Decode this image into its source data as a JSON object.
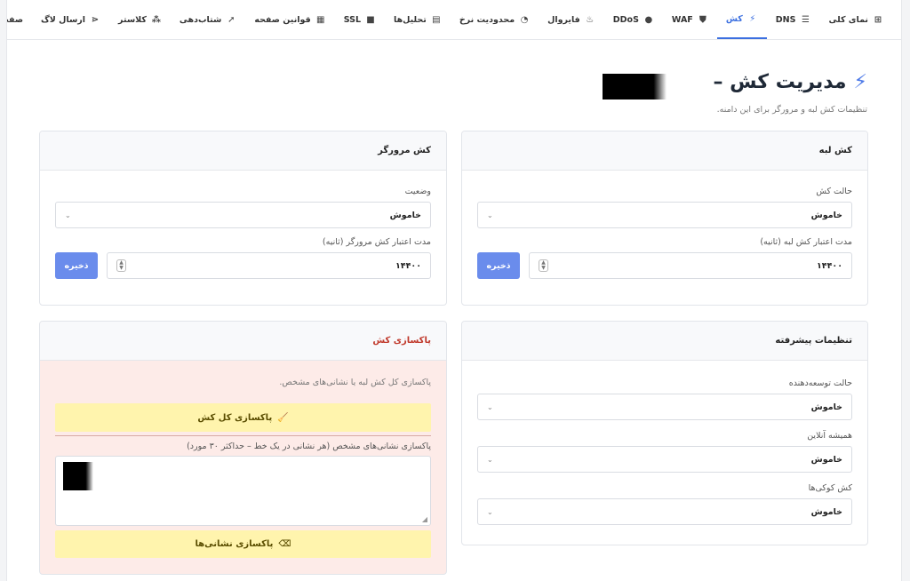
{
  "tabs": [
    {
      "label": "نمای کلی",
      "icon": "grid-icon",
      "glyph": "⊞",
      "active": false
    },
    {
      "label": "DNS",
      "icon": "server-icon",
      "glyph": "☰",
      "active": false
    },
    {
      "label": "کش",
      "icon": "bolt-icon",
      "glyph": "⚡",
      "active": true
    },
    {
      "label": "WAF",
      "icon": "shield-icon",
      "glyph": "⛊",
      "active": false
    },
    {
      "label": "DDoS",
      "icon": "bomb-icon",
      "glyph": "●",
      "active": false
    },
    {
      "label": "فایروال",
      "icon": "fire-icon",
      "glyph": "♨",
      "active": false
    },
    {
      "label": "محدودیت نرخ",
      "icon": "gauge-icon",
      "glyph": "◔",
      "active": false
    },
    {
      "label": "تحلیل‌ها",
      "icon": "chart-icon",
      "glyph": "▤",
      "active": false
    },
    {
      "label": "SSL",
      "icon": "lock-icon",
      "glyph": "■",
      "active": false
    },
    {
      "label": "قوانین صفحه",
      "icon": "list-icon",
      "glyph": "▦",
      "active": false
    },
    {
      "label": "شتاب‌دهی",
      "icon": "rocket-icon",
      "glyph": "➚",
      "active": false
    },
    {
      "label": "کلاستر",
      "icon": "cubes-icon",
      "glyph": "⁂",
      "active": false
    },
    {
      "label": "ارسال لاگ",
      "icon": "share-icon",
      "glyph": "⋖",
      "active": false
    },
    {
      "label": "صفحات سفارشی",
      "icon": "",
      "glyph": "",
      "active": false
    }
  ],
  "header": {
    "title": "مدیریت کش –",
    "subtitle": "تنظیمات کش لبه و مرورگر برای این دامنه."
  },
  "edge": {
    "title": "کش لبه",
    "mode_label": "حالت کش",
    "mode_value": "خاموش",
    "ttl_label": "مدت اعتبار کش لبه (ثانیه)",
    "ttl_value": "۱۴۴۰۰",
    "save": "ذخیره"
  },
  "browser": {
    "title": "کش مرورگر",
    "status_label": "وضعیت",
    "status_value": "خاموش",
    "ttl_label": "مدت اعتبار کش مرورگر (ثانیه)",
    "ttl_value": "۱۴۴۰۰",
    "save": "ذخیره"
  },
  "advanced": {
    "title": "تنظیمات پیشرفته",
    "dev_label": "حالت توسعه‌دهنده",
    "dev_value": "خاموش",
    "online_label": "همیشه آنلاین",
    "online_value": "خاموش",
    "cookie_label": "کش کوکی‌ها",
    "cookie_value": "خاموش"
  },
  "purge": {
    "title": "پاکسازی کش",
    "desc": "پاکسازی کل کش لبه یا نشانی‌های مشخص.",
    "all_button": "پاکسازی کل کش",
    "urls_label": "پاکسازی نشانی‌های مشخص (هر نشانی در یک خط – حداکثر ۳۰ مورد)",
    "urls_button": "پاکسازی نشانی‌ها"
  }
}
